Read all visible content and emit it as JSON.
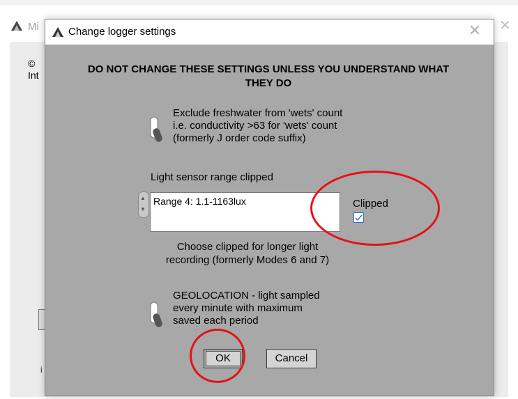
{
  "background_window": {
    "title": "Mi",
    "copyright": "©",
    "int_text": "Int",
    "small_text": "i"
  },
  "dialog": {
    "title": "Change logger settings",
    "close_glyph": "✕",
    "warning": "DO NOT CHANGE THESE SETTINGS UNLESS YOU UNDERSTAND WHAT THEY DO",
    "freshwater_option": {
      "lines": [
        "Exclude freshwater from 'wets' count",
        "i.e. conductivity >63 for 'wets' count",
        "(formerly J order code suffix)"
      ]
    },
    "light_sensor": {
      "label": "Light sensor range clipped",
      "selected_range": "Range 4: 1.1-1163lux",
      "clipped_label": "Clipped",
      "clipped_checked": true,
      "note_lines": [
        "Choose clipped for longer light",
        "recording (formerly Modes 6 and 7)"
      ]
    },
    "geolocation_option": {
      "lines": [
        "GEOLOCATION - light sampled",
        "every minute with maximum",
        "saved each period"
      ]
    },
    "buttons": {
      "ok": "OK",
      "cancel": "Cancel"
    }
  },
  "colors": {
    "dialog_bg": "#a8a8a8",
    "annotation_red": "#e4111a",
    "checkbox_blue": "#2a6fd8"
  },
  "icons": [
    "app-icon",
    "close-icon",
    "toggle-switch-icon",
    "spinner-icon",
    "checkmark-icon"
  ]
}
